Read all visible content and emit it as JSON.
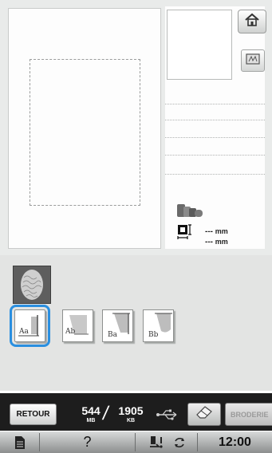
{
  "preview": {
    "frame_style": "dashed"
  },
  "toolbar_right": {
    "home_icon": "home-icon",
    "frame_icon": "embroidery-frame-icon"
  },
  "size": {
    "height_value": "---",
    "height_unit": "mm",
    "width_value": "---",
    "width_unit": "mm"
  },
  "stitch_styles": [
    {
      "label": "Aa",
      "icon": "stitch-style-aa-icon",
      "selected": true
    },
    {
      "label": "Ab",
      "icon": "stitch-style-ab-icon",
      "selected": false
    },
    {
      "label": "Ba",
      "icon": "stitch-style-ba-icon",
      "selected": false
    },
    {
      "label": "Bb",
      "icon": "stitch-style-bb-icon",
      "selected": false
    }
  ],
  "bottom_bar": {
    "retour_label": "RETOUR",
    "memory_used": "544",
    "memory_used_unit": "MB",
    "memory_total": "1905",
    "memory_total_unit": "KB",
    "usb_icon": "usb-icon",
    "eraser_icon": "eraser-icon",
    "broderie_label": "BRODERIE"
  },
  "status_bar": {
    "manual_icon": "document-icon",
    "help_label": "?",
    "presser_foot_icon": "presser-foot-icon",
    "rotate_icon": "rotate-icon",
    "clock": "12:00"
  },
  "colors": {
    "accent_selection": "#2a8fe0",
    "bottom_bar_bg": "#1d1d1d",
    "panel_bg": "#e3e4e3"
  }
}
